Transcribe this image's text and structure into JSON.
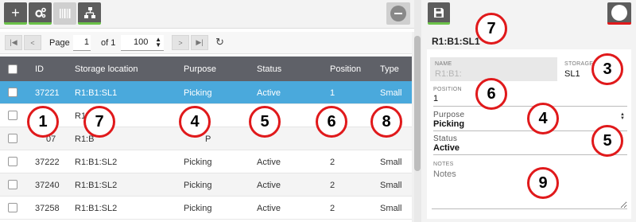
{
  "toolbar": {
    "add_icon": "plus-icon",
    "settings_icon": "gears-icon",
    "barcode_icon": "barcode-icon",
    "hierarchy_icon": "hierarchy-icon",
    "remove_icon": "minus-circle-icon"
  },
  "pager": {
    "page_label": "Page",
    "page_value": "1",
    "of_label": "of 1",
    "page_size": "100"
  },
  "grid": {
    "columns": [
      "ID",
      "Storage location",
      "Purpose",
      "Status",
      "Position",
      "Type"
    ],
    "rows": [
      {
        "id": "37221",
        "location": "R1:B1:SL1",
        "purpose": "Picking",
        "status": "Active",
        "position": "1",
        "type": "Small"
      },
      {
        "id": "",
        "location": "R1",
        "purpose": "",
        "status": "",
        "position": "",
        "type": ""
      },
      {
        "id": "07",
        "location": "R1:B",
        "purpose": "P",
        "status": "",
        "position": "",
        "type": ""
      },
      {
        "id": "37222",
        "location": "R1:B1:SL2",
        "purpose": "Picking",
        "status": "Active",
        "position": "2",
        "type": "Small"
      },
      {
        "id": "37240",
        "location": "R1:B1:SL2",
        "purpose": "Picking",
        "status": "Active",
        "position": "2",
        "type": "Small"
      },
      {
        "id": "37258",
        "location": "R1:B1:SL2",
        "purpose": "Picking",
        "status": "Active",
        "position": "2",
        "type": "Small"
      }
    ]
  },
  "detail": {
    "title": "R1:B1:SL1",
    "name_label": "NAME",
    "name_value": "R1:B1:",
    "storage_label": "STORAGE",
    "storage_value": "SL1",
    "position_label": "POSITION",
    "position_value": "1",
    "purpose_label": "Purpose",
    "purpose_value": "Picking",
    "status_label": "Status",
    "status_value": "Active",
    "notes_label": "NOTES",
    "notes_placeholder": "Notes"
  },
  "badges": [
    "1",
    "7",
    "4",
    "5",
    "6",
    "8",
    "7",
    "3",
    "6",
    "4",
    "5",
    "9"
  ],
  "colors": {
    "selected_row": "#4aa9dc",
    "header": "#5f6168",
    "badge_border": "#e0191b",
    "add_accent": "#6cc24a",
    "remove_accent": "#e0191b"
  }
}
